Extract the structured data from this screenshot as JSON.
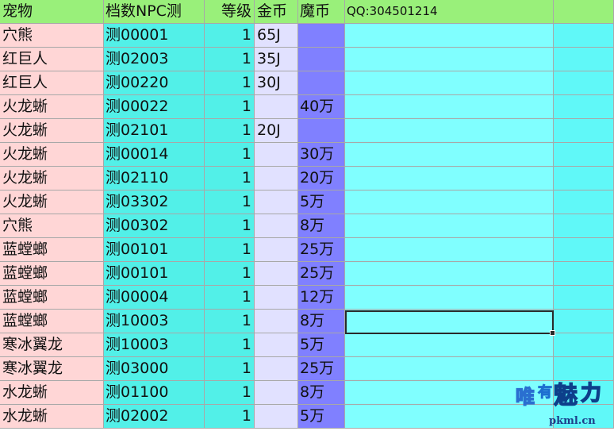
{
  "header": [
    "宠物",
    "档数NPC测",
    "等级",
    "金币",
    "魔币",
    "QQ:304501214",
    ""
  ],
  "rows": [
    [
      "穴熊",
      "测00001",
      "1",
      "65J",
      "",
      "",
      ""
    ],
    [
      "红巨人",
      "测02003",
      "1",
      "35J",
      "",
      "",
      ""
    ],
    [
      "红巨人",
      "测00220",
      "1",
      "30J",
      "",
      "",
      ""
    ],
    [
      "火龙蜥",
      "测00022",
      "1",
      "",
      "40万",
      "",
      ""
    ],
    [
      "火龙蜥",
      "测02101",
      "1",
      "20J",
      "",
      "",
      ""
    ],
    [
      "火龙蜥",
      "测00014",
      "1",
      "",
      "30万",
      "",
      ""
    ],
    [
      "火龙蜥",
      "测02110",
      "1",
      "",
      "20万",
      "",
      ""
    ],
    [
      "火龙蜥",
      "测03302",
      "1",
      "",
      "5万",
      "",
      ""
    ],
    [
      "穴熊",
      "测00302",
      "1",
      "",
      "8万",
      "",
      ""
    ],
    [
      "蓝螳螂",
      "测00101",
      "1",
      "",
      "25万",
      "",
      ""
    ],
    [
      "蓝螳螂",
      "测00101",
      "1",
      "",
      "25万",
      "",
      ""
    ],
    [
      "蓝螳螂",
      "测00004",
      "1",
      "",
      "12万",
      "",
      ""
    ],
    [
      "蓝螳螂",
      "测10003",
      "1",
      "",
      "8万",
      "",
      ""
    ],
    [
      "寒冰翼龙",
      "测10003",
      "1",
      "",
      "5万",
      "",
      ""
    ],
    [
      "寒冰翼龙",
      "测03000",
      "1",
      "",
      "25万",
      "",
      ""
    ],
    [
      "水龙蜥",
      "测01100",
      "1",
      "",
      "8万",
      "",
      ""
    ],
    [
      "水龙蜥",
      "测02002",
      "1",
      "",
      "5万",
      "",
      ""
    ]
  ],
  "selection": {
    "row": 13,
    "col": 6
  },
  "watermark": {
    "text": "唯有魅力",
    "site": "pkml.cn"
  },
  "colors": {
    "header": "#99f07a",
    "pet_col": "#ffd6d6",
    "cyan_col": "#52f0e8",
    "gold_col": "#e1e1ff",
    "magic_col": "#8080ff",
    "note_col": "#80ffff"
  }
}
